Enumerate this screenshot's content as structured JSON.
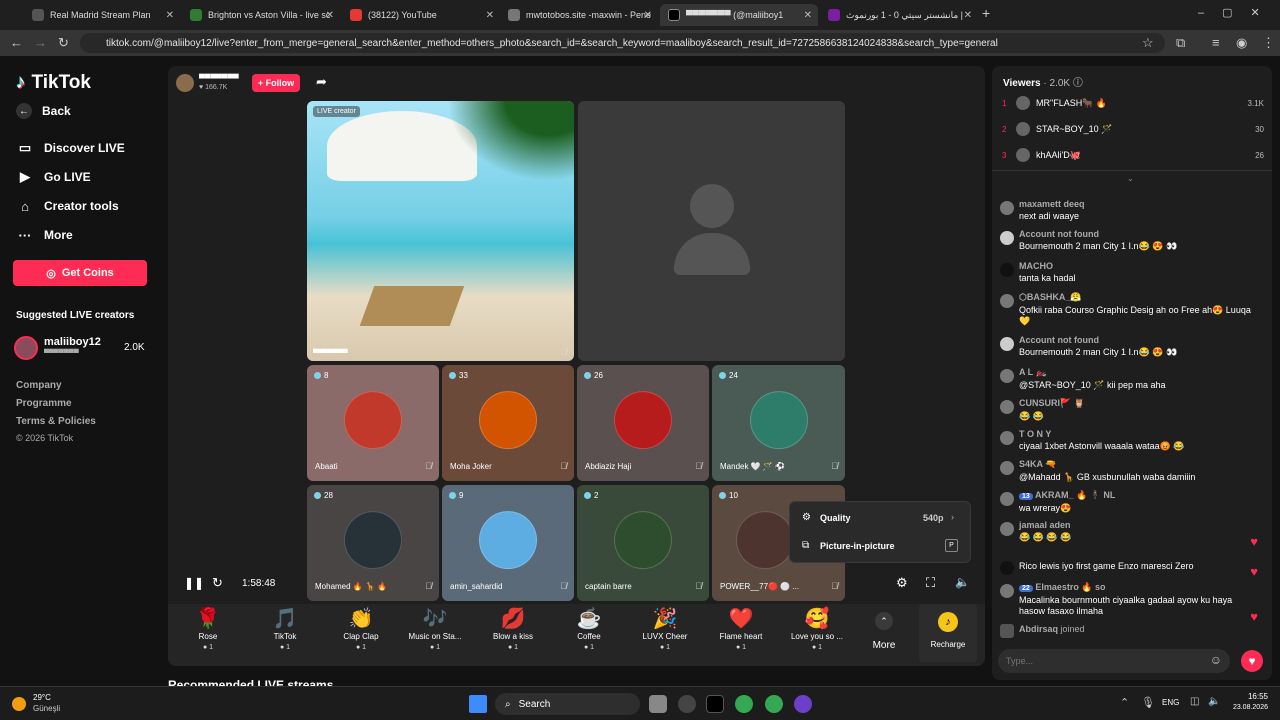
{
  "browser": {
    "tabs": [
      {
        "title": "Real Madrid Stream Plan",
        "color": "#555555"
      },
      {
        "title": "Brighton vs Aston Villa - live sc",
        "color": "#2e7d32"
      },
      {
        "title": "(38122) YouTube",
        "color": "#e53935"
      },
      {
        "title": "mwtotobos.site -maxwin - Pene",
        "color": "#777777"
      },
      {
        "title": "▀▀▀▀▀▀▀ (@maliiboy1",
        "color": "#000000"
      },
      {
        "title": "مانشستر سيتي 0 - 1 بورنموث |",
        "color": "#7b1fa2"
      }
    ],
    "url": "tiktok.com/@maliiboy12/live?enter_from_merge=general_search&enter_method=others_photo&search_id=&search_keyword=maaliboy&search_result_id=7272586638124024838&search_type=general"
  },
  "sidebar": {
    "logo": "TikTok",
    "back": "Back",
    "menu": [
      "Discover LIVE",
      "Go LIVE",
      "Creator tools",
      "More"
    ],
    "coins_button": "Get Coins",
    "suggested_title": "Suggested LIVE creators",
    "suggested": [
      {
        "name": "maliiboy12",
        "sub": "▀▀▀▀▀▀▀",
        "count": "2.0K"
      }
    ],
    "footer": [
      "Company",
      "Programme",
      "Terms & Policies",
      "© 2026 TikTok"
    ]
  },
  "stream": {
    "host_name": "▀▀▀▀▀▀▀",
    "host_likes": "166.7K",
    "follow": "+ Follow",
    "live_badge": "LIVE creator",
    "host_tile_label": "▀▀▀▀▀▀▀",
    "guests": [
      {
        "name": "Abaati",
        "count": "8",
        "color": "#c0392b"
      },
      {
        "name": "Moha Joker",
        "count": "33",
        "color": "#d35400"
      },
      {
        "name": "Abdiaziz Haji",
        "count": "26",
        "color": "#b71c1c"
      },
      {
        "name": "Mandek 🤍 🪄 ⚽",
        "count": "24",
        "color": "#2e7d6b"
      },
      {
        "name": "Mohamed 🔥 🦒 🔥",
        "count": "28",
        "color": "#263238"
      },
      {
        "name": "amin_sahardid",
        "count": "9",
        "color": "#5dade2"
      },
      {
        "name": "captain barre",
        "count": "2",
        "color": "#2e4d2e"
      },
      {
        "name": "POWER__77🔴 ⚪ ...",
        "count": "10",
        "color": "#4e342e"
      }
    ],
    "elapsed": "1:58:48",
    "settings_menu": {
      "quality_label": "Quality",
      "quality_value": "540p",
      "pip_label": "Picture-in-picture",
      "pip_key": "P"
    }
  },
  "gifts": [
    {
      "name": "Rose",
      "icon": "🌹",
      "price": "1"
    },
    {
      "name": "TikTok",
      "icon": "🎵",
      "price": "1"
    },
    {
      "name": "Clap Clap",
      "icon": "👏",
      "price": "1"
    },
    {
      "name": "Music on Sta...",
      "icon": "🎶",
      "price": "1"
    },
    {
      "name": "Blow a kiss",
      "icon": "💋",
      "price": "1"
    },
    {
      "name": "Coffee",
      "icon": "☕",
      "price": "1"
    },
    {
      "name": "LUVX Cheer",
      "icon": "🎉",
      "price": "1"
    },
    {
      "name": "Flame heart",
      "icon": "❤️",
      "price": "1"
    },
    {
      "name": "Love you so ...",
      "icon": "🥰",
      "price": "1"
    }
  ],
  "gift_more": "More",
  "recharge": "Recharge",
  "recommended_title": "Recommended LIVE streams",
  "viewers": {
    "title": "Viewers",
    "count": "· 2.0K",
    "top": [
      {
        "rank": "1",
        "name": "MR\"FLASH🐂 🔥",
        "score": "3.1K"
      },
      {
        "rank": "2",
        "name": "STAR~BOY_10 🪄",
        "score": "30"
      },
      {
        "rank": "3",
        "name": "khAAli'D🐙",
        "score": "26"
      }
    ]
  },
  "comments": [
    {
      "user": "maxamett deeq",
      "text": "next adi waaye"
    },
    {
      "user": "Account not found",
      "text": "Bournemouth 2 man City 1 I.n😂 😍 👀"
    },
    {
      "user": "MACHO",
      "text": "tanta ka hadal"
    },
    {
      "user": "⬡BASHKA_😤",
      "text": "Qofkii raba Courso Graphic Desig ah oo Free ah😍 Luuqa 💛"
    },
    {
      "user": "Account not found",
      "text": "Bournemouth 2 man City 1 I.n😂 😍 👀"
    },
    {
      "user": "A L 🏍️",
      "text": "@STAR~BOY_10 🪄 kii pep ma aha"
    },
    {
      "user": "CUNSURI🚩 🦉",
      "text": "😂 😂"
    },
    {
      "user": "T O N Y",
      "text": "ciyaal 1xbet Astonvill waaala wataa😡 😂"
    },
    {
      "user": "S4KA 🔫",
      "text": "@Mahadd 🦒 GB xusbunullah waba damiiin"
    },
    {
      "user": "AKRAM_ 🔥 🕴 NL",
      "badge": "13",
      "text": "wa wreray😍"
    },
    {
      "user": "jamaal aden",
      "text": "😂 😂 😂 😂"
    },
    {
      "user": "",
      "text": "Rico lewis iyo first game Enzo maresci Zero"
    },
    {
      "user": "Elmaestro 🔥 so",
      "badge": "22",
      "text": "Macalinka bournmouth ciyaalka gadaal ayow ku haya hasow fasaxo ilmaha"
    }
  ],
  "joined": {
    "user": "Abdirsaq",
    "text": "joined"
  },
  "chat_input_placeholder": "Type...",
  "taskbar": {
    "weather_temp": "29°C",
    "weather_place": "Güneşli",
    "search": "Search",
    "lang": "ENG",
    "time": "16:55",
    "date": "23.08.2026"
  }
}
